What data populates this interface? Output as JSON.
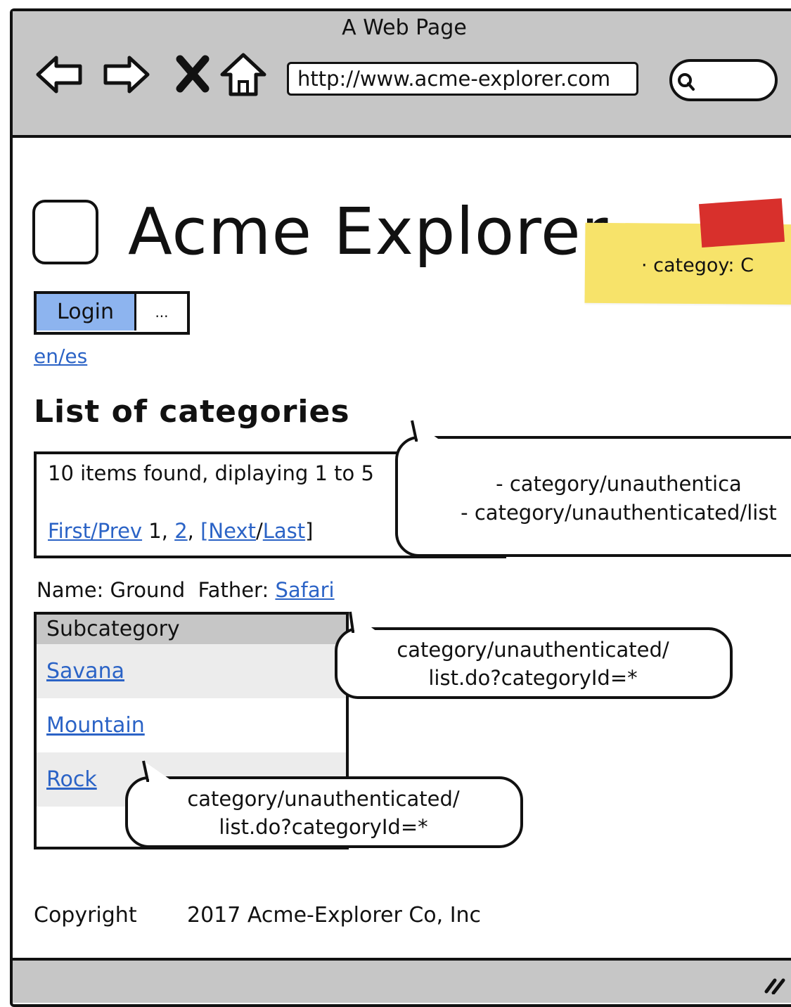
{
  "browser": {
    "window_title": "A Web Page",
    "url": "http://www.acme-explorer.com"
  },
  "site": {
    "title": "Acme Explorer",
    "login_label": "Login",
    "login_more_label": "...",
    "language_link": "en/es"
  },
  "sticky_note": {
    "text": "·   categoy: C"
  },
  "list": {
    "heading": "List of categories",
    "items_found": "10 items found, diplaying 1 to 5",
    "pager": {
      "first_prev": "First/Prev",
      "page1": "1",
      "page2": "2",
      "next": "Next",
      "last": "Last"
    }
  },
  "callouts": {
    "pager_note_line1": "- category/unauthentica",
    "pager_note_line2": "- category/unauthenticated/list",
    "subcategory_note_line1": "category/unauthenticated/",
    "subcategory_note_line2": "list.do?categoryId=*",
    "rock_note_line1": "category/unauthenticated/",
    "rock_note_line2": "list.do?categoryId=*"
  },
  "detail": {
    "name_label": "Name:",
    "name_value": "Ground",
    "father_label": "Father:",
    "father_value": "Safari"
  },
  "table": {
    "header": "Subcategory",
    "rows": [
      "Savana",
      "Mountain",
      "Rock"
    ],
    "row_colors": [
      "#ececec",
      "#ffffff",
      "#ececec"
    ]
  },
  "footer": {
    "copyright_label": "Copyright",
    "copyright_text": "2017 Acme-Explorer Co, Inc"
  },
  "colors": {
    "chrome": "#c6c6c6",
    "link": "#2b63c6",
    "login_button": "#8db4ef",
    "sticky_note": "#f7e36a",
    "sticky_pin": "#d8302c"
  }
}
